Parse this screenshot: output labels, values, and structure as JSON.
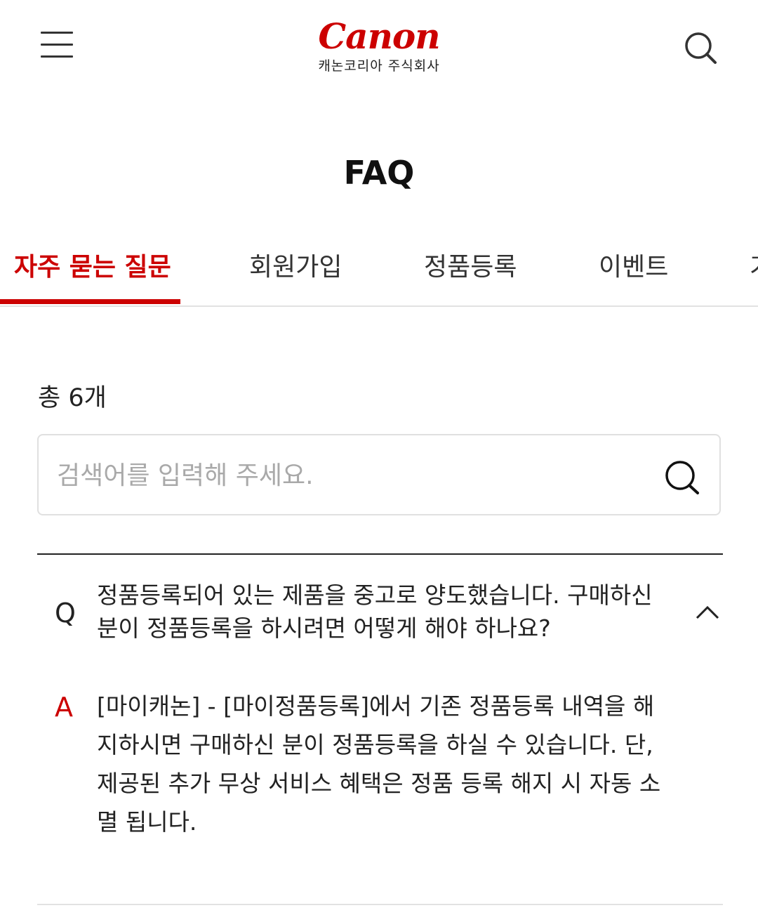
{
  "header": {
    "logo_text": "Canon",
    "logo_subtitle": "캐논코리아 주식회사",
    "menu_icon": "hamburger-menu-icon",
    "search_icon": "search-icon"
  },
  "page": {
    "title": "FAQ"
  },
  "tabs": [
    {
      "label": "자주 묻는 질문",
      "active": true
    },
    {
      "label": "회원가입",
      "active": false
    },
    {
      "label": "정품등록",
      "active": false
    },
    {
      "label": "이벤트",
      "active": false
    },
    {
      "label": "기",
      "active": false
    }
  ],
  "count_text": "총 6개",
  "search": {
    "placeholder": "검색어를 입력해 주세요.",
    "value": ""
  },
  "faq": {
    "q_mark": "Q",
    "a_mark": "A",
    "items": [
      {
        "question": "정품등록되어 있는 제품을 중고로 양도했습니다. 구매하신 분이 정품등록을 하시려면 어떻게 해야 하나요?",
        "answer": "[마이캐논] - [마이정품등록]에서 기존 정품등록 내역을 해지하시면 구매하신 분이 정품등록을 하실 수 있습니다. 단, 제공된 추가 무상 서비스 혜택은 정품 등록 해지 시 자동 소멸 됩니다.",
        "expanded": true
      }
    ]
  },
  "colors": {
    "brand_red": "#cc0000",
    "text": "#222222",
    "placeholder": "#a9a9a9",
    "border": "#e0e0e0"
  }
}
